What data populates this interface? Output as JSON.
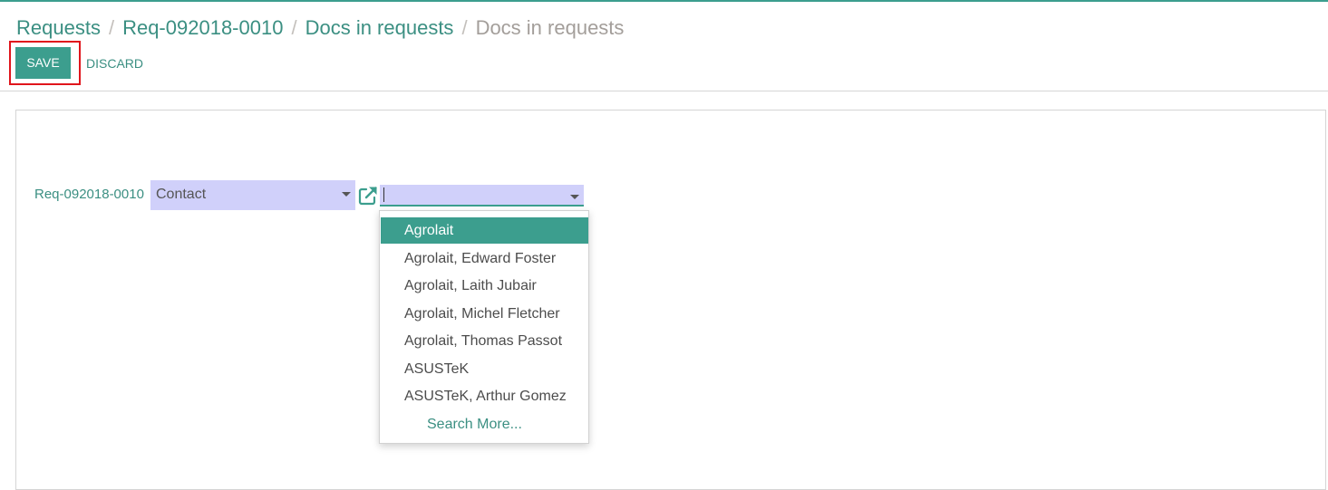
{
  "breadcrumb": {
    "items": [
      "Requests",
      "Req-092018-0010",
      "Docs in requests"
    ],
    "current": "Docs in requests",
    "separator": "/"
  },
  "toolbar": {
    "save_label": "SAVE",
    "discard_label": "DISCARD"
  },
  "form": {
    "record_link": "Req-092018-0010",
    "type_select_value": "Contact",
    "partner_input_value": ""
  },
  "dropdown": {
    "items": [
      "Agrolait",
      "Agrolait, Edward Foster",
      "Agrolait, Laith Jubair",
      "Agrolait, Michel Fletcher",
      "Agrolait, Thomas Passot",
      "ASUSTeK",
      "ASUSTeK, Arthur Gomez"
    ],
    "selected_index": 0,
    "search_more_label": "Search More..."
  },
  "icons": {
    "external_link": "external-link-icon",
    "dropdown_caret": "caret-down-icon"
  },
  "colors": {
    "accent": "#3c9e8e",
    "link": "#3b8f82",
    "input_bg": "#d0d0fa",
    "highlight": "#e0151c"
  }
}
